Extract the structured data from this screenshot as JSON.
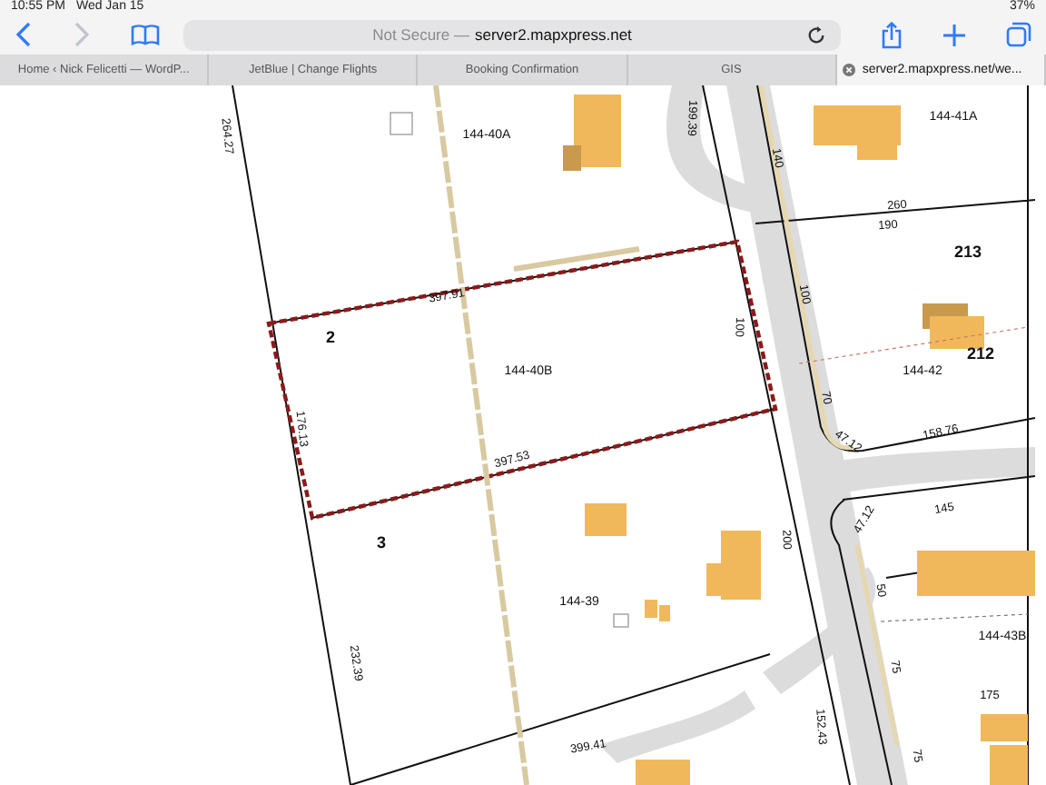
{
  "status_bar": {
    "time": "10:55 PM",
    "date": "Wed Jan 15",
    "battery": "37%"
  },
  "address_bar": {
    "security": "Not Secure —",
    "domain": "server2.mapxpress.net"
  },
  "tabs": [
    {
      "label": "Home ‹ Nick Felicetti — WordP...",
      "selected": false
    },
    {
      "label": "JetBlue | Change Flights",
      "selected": false
    },
    {
      "label": "Booking Confirmation",
      "selected": false
    },
    {
      "label": "GIS",
      "selected": false
    },
    {
      "label": "server2.mapxpress.net/we...",
      "selected": true
    }
  ],
  "map": {
    "labels": [
      {
        "text": "264.27",
        "kind": "dimension"
      },
      {
        "text": "144-40A",
        "kind": "parcel"
      },
      {
        "text": "199.39",
        "kind": "dimension"
      },
      {
        "text": "140",
        "kind": "dimension"
      },
      {
        "text": "144-41A",
        "kind": "parcel"
      },
      {
        "text": "260",
        "kind": "dimension"
      },
      {
        "text": "190",
        "kind": "dimension"
      },
      {
        "text": "213",
        "kind": "lot"
      },
      {
        "text": "397.91",
        "kind": "dimension"
      },
      {
        "text": "2",
        "kind": "lot"
      },
      {
        "text": "144-40B",
        "kind": "parcel"
      },
      {
        "text": "100",
        "kind": "dimension"
      },
      {
        "text": "100",
        "kind": "dimension"
      },
      {
        "text": "212",
        "kind": "lot"
      },
      {
        "text": "144-42",
        "kind": "parcel"
      },
      {
        "text": "70",
        "kind": "dimension"
      },
      {
        "text": "47.12",
        "kind": "dimension"
      },
      {
        "text": "158.76",
        "kind": "dimension"
      },
      {
        "text": "176.13",
        "kind": "dimension"
      },
      {
        "text": "397.53",
        "kind": "dimension"
      },
      {
        "text": "145",
        "kind": "dimension"
      },
      {
        "text": "47.12",
        "kind": "dimension"
      },
      {
        "text": "3",
        "kind": "lot"
      },
      {
        "text": "200",
        "kind": "dimension"
      },
      {
        "text": "144-39",
        "kind": "parcel"
      },
      {
        "text": "50",
        "kind": "dimension"
      },
      {
        "text": "144-43B",
        "kind": "parcel"
      },
      {
        "text": "232.39",
        "kind": "dimension"
      },
      {
        "text": "75",
        "kind": "dimension"
      },
      {
        "text": "175",
        "kind": "dimension"
      },
      {
        "text": "399.41",
        "kind": "dimension"
      },
      {
        "text": "152.43",
        "kind": "dimension"
      },
      {
        "text": "75",
        "kind": "dimension"
      }
    ]
  }
}
